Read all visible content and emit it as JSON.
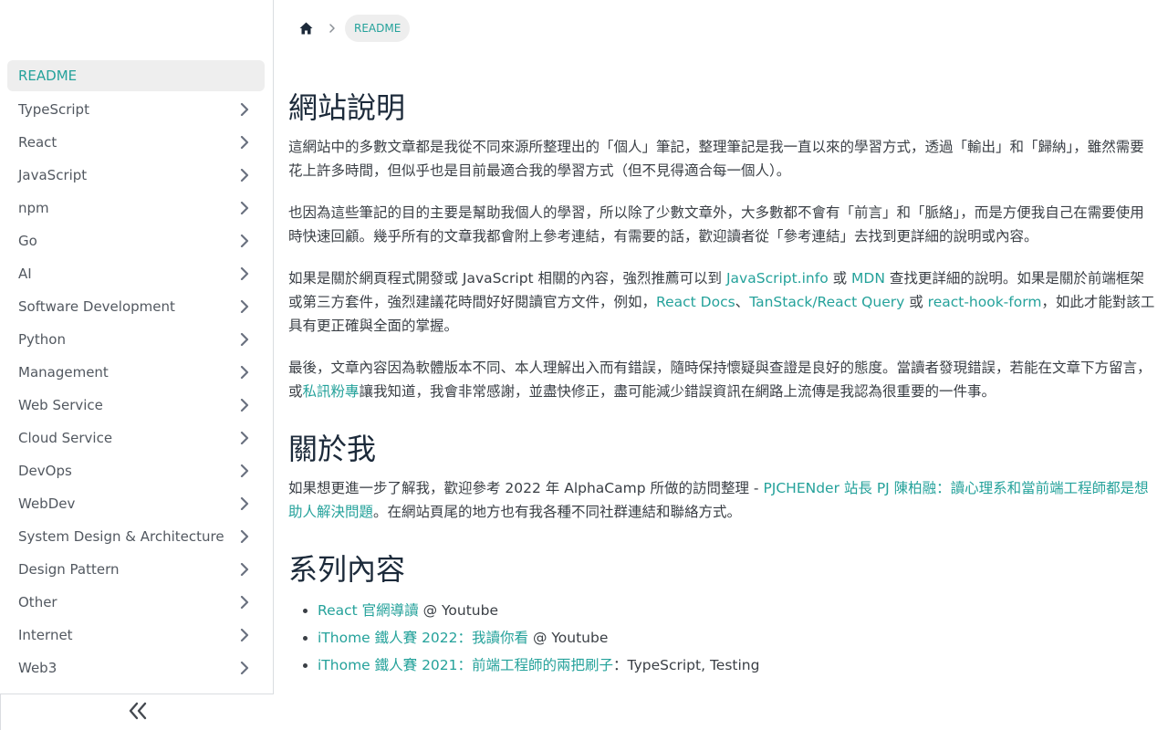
{
  "sidebar": {
    "items": [
      {
        "label": "README",
        "active": true
      },
      {
        "label": "TypeScript"
      },
      {
        "label": "React"
      },
      {
        "label": "JavaScript"
      },
      {
        "label": "npm"
      },
      {
        "label": "Go"
      },
      {
        "label": "AI"
      },
      {
        "label": "Software Development"
      },
      {
        "label": "Python"
      },
      {
        "label": "Management"
      },
      {
        "label": "Web Service"
      },
      {
        "label": "Cloud Service"
      },
      {
        "label": "DevOps"
      },
      {
        "label": "WebDev"
      },
      {
        "label": "System Design & Architecture"
      },
      {
        "label": "Design Pattern"
      },
      {
        "label": "Other"
      },
      {
        "label": "Internet"
      },
      {
        "label": "Web3"
      }
    ],
    "collapse_icon": "double-chevron-left-icon"
  },
  "breadcrumb": {
    "home_icon": "home-icon",
    "current": "README"
  },
  "article": {
    "h1": "網站說明",
    "p1": "這網站中的多數文章都是我從不同來源所整理出的「個人」筆記，整理筆記是我一直以來的學習方式，透過「輸出」和「歸納」，雖然需要花上許多時間，但似乎也是目前最適合我的學習方式（但不見得適合每一個人）。",
    "p2": "也因為這些筆記的目的主要是幫助我個人的學習，所以除了少數文章外，大多數都不會有「前言」和「脈絡」，而是方便我自己在需要使用時快速回顧。幾乎所有的文章我都會附上參考連結，有需要的話，歡迎讀者從「參考連結」去找到更詳細的說明或內容。",
    "p3": {
      "t1": "如果是關於網頁程式開發或 JavaScript 相關的內容，強烈推薦可以到 ",
      "l1": "JavaScript.info",
      "t2": " 或 ",
      "l2": "MDN",
      "t3": " 查找更詳細的說明。如果是關於前端框架或第三方套件，強烈建議花時間好好閱讀官方文件，例如，",
      "l3": "React Docs",
      "t4": "、",
      "l4": "TanStack/React Query",
      "t5": " 或 ",
      "l5": "react-hook-form",
      "t6": "，如此才能對該工具有更正確與全面的掌握。"
    },
    "p4": {
      "t1": "最後，文章內容因為軟體版本不同、本人理解出入而有錯誤，隨時保持懷疑與查證是良好的態度。當讀者發現錯誤，若能在文章下方留言，或",
      "l1": "私訊粉專",
      "t2": "讓我知道，我會非常感謝，並盡快修正，盡可能減少錯誤資訊在網路上流傳是我認為很重要的一件事。"
    },
    "h2_about": "關於我",
    "p5": {
      "t1": "如果想更進一步了解我，歡迎參考 2022 年 AlphaCamp 所做的訪問整理 - ",
      "l1": "PJCHENder 站長 PJ 陳柏融：讀心理系和當前端工程師都是想助人解決問題",
      "t2": "。在網站頁尾的地方也有我各種不同社群連結和聯絡方式。"
    },
    "h2_series": "系列內容",
    "series": [
      {
        "link": "React 官網導讀",
        "suffix": " @ Youtube"
      },
      {
        "link": "iThome 鐵人賽 2022：我讀你看",
        "suffix": " @ Youtube"
      },
      {
        "link": "iThome 鐵人賽 2021：前端工程師的兩把刷子",
        "suffix": "：TypeScript, Testing"
      }
    ]
  },
  "colors": {
    "accent": "#25a29b",
    "active_bg": "#eeeeee",
    "heading": "#1c2a3a"
  }
}
